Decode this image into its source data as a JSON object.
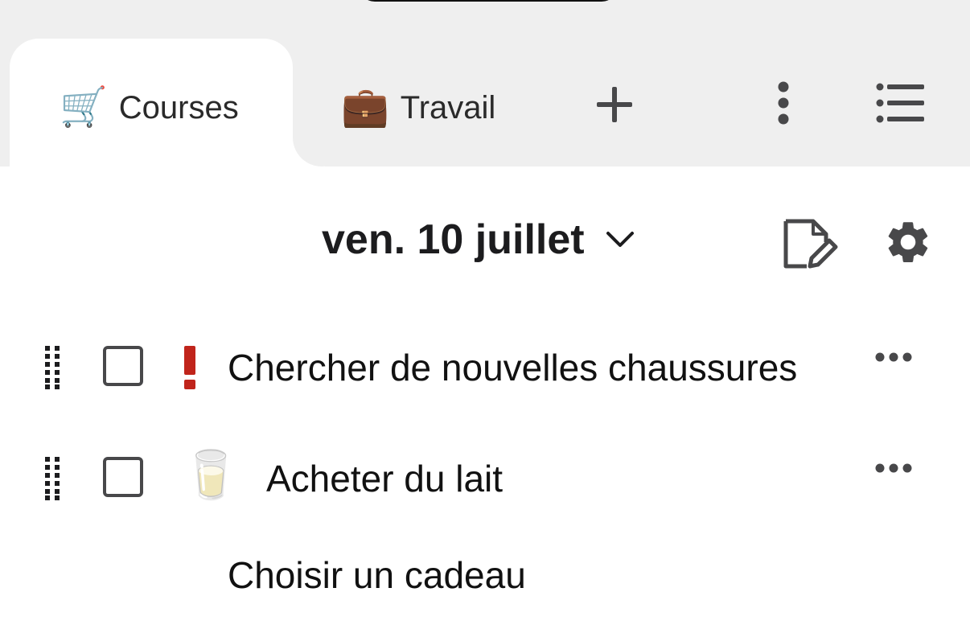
{
  "tabs": [
    {
      "emoji": "🛒",
      "label": "Courses",
      "active": true
    },
    {
      "emoji": "💼",
      "label": "Travail",
      "active": false
    }
  ],
  "toolbar_icons": [
    "plus-icon",
    "vertical-dots-icon",
    "list-icon"
  ],
  "header": {
    "date": "ven. 10 juillet",
    "icons": [
      "chevron-down-icon",
      "edit-note-icon",
      "gear-icon"
    ]
  },
  "tasks": [
    {
      "label": "Chercher de nouvelles chaussures",
      "marker": "!",
      "marker_color": "#c0241b",
      "checked": false
    },
    {
      "label": "Acheter du lait",
      "emoji": "🥛",
      "checked": false
    },
    {
      "label": "Choisir un cadeau",
      "checked": false
    }
  ],
  "colors": {
    "background": "#efefef",
    "active_tab": "#ffffff",
    "icon": "#48484a",
    "priority": "#c0241b"
  }
}
